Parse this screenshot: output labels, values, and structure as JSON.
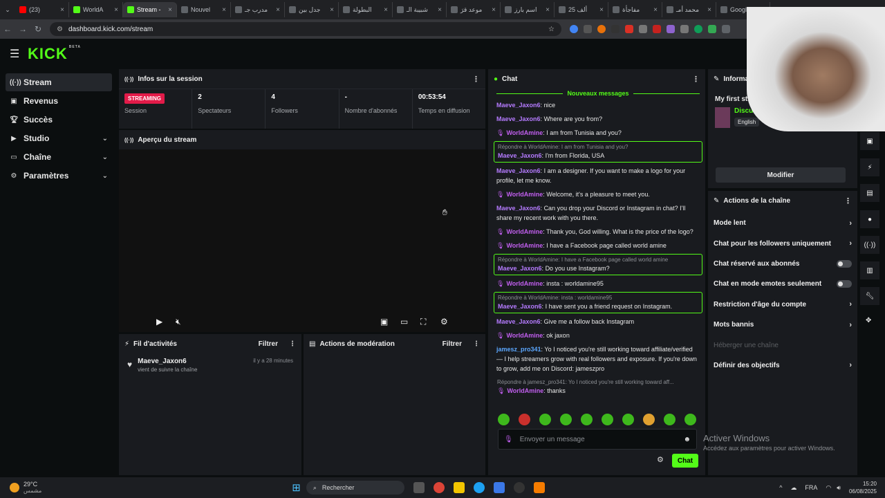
{
  "browser": {
    "tabs": [
      {
        "label": "(23)"
      },
      {
        "label": "WorldA"
      },
      {
        "label": "Stream -"
      },
      {
        "label": "Nouvel"
      },
      {
        "label": "مدرب جـ"
      },
      {
        "label": "جدل بين"
      },
      {
        "label": "البطولة"
      },
      {
        "label": "شبيبة الـ"
      },
      {
        "label": "موعد قرَ"
      },
      {
        "label": "اسم بارز"
      },
      {
        "label": "25 ألف"
      },
      {
        "label": "مفاجأة"
      },
      {
        "label": "محمد أمـ"
      },
      {
        "label": "Google"
      }
    ],
    "url": "dashboard.kick.com/stream"
  },
  "brand": {
    "logo": "KICK",
    "beta": "BETA",
    "accent": "#53fc18"
  },
  "sidebar": {
    "items": [
      {
        "label": "Stream",
        "icon": "broadcast-icon"
      },
      {
        "label": "Revenus",
        "icon": "wallet-icon"
      },
      {
        "label": "Succès",
        "icon": "trophy-icon"
      },
      {
        "label": "Studio",
        "icon": "camera-icon"
      },
      {
        "label": "Chaîne",
        "icon": "tv-icon"
      },
      {
        "label": "Paramètres",
        "icon": "gear-icon"
      }
    ]
  },
  "session": {
    "title": "Infos sur la session",
    "status_badge": "STREAMING",
    "stats": [
      {
        "value": "",
        "label": "Session"
      },
      {
        "value": "2",
        "label": "Spectateurs"
      },
      {
        "value": "4",
        "label": "Followers"
      },
      {
        "value": "-",
        "label": "Nombre d'abonnés"
      },
      {
        "value": "00:53:54",
        "label": "Temps en diffusion"
      }
    ],
    "preview_title": "Aperçu du stream"
  },
  "activity": {
    "title": "Fil d'activités",
    "filter": "Filtrer",
    "items": [
      {
        "user": "Maeve_Jaxon6",
        "action": "vient de suivre la chaîne",
        "time": "il y a 28 minutes"
      }
    ]
  },
  "moderation": {
    "title": "Actions de modération",
    "filter": "Filtrer"
  },
  "chat": {
    "title": "Chat",
    "new_messages": "Nouveaux messages",
    "messages": [
      {
        "user": "Maeve_Jaxon6",
        "text": "nice"
      },
      {
        "user": "Maeve_Jaxon6",
        "text": "Where are you from?"
      },
      {
        "user": "WorldAmine",
        "text": "I am from Tunisia and you?"
      },
      {
        "reply": "Répondre à WorldAmine: I am from Tunisia and you?",
        "user": "Maeve_Jaxon6",
        "text": "I'm from Florida, USA"
      },
      {
        "user": "Maeve_Jaxon6",
        "text": "I am a designer. If you want to make a logo for your profile, let me know."
      },
      {
        "user": "WorldAmine",
        "text": "Welcome, it's a pleasure to meet you."
      },
      {
        "user": "Maeve_Jaxon6",
        "text": "Can you drop your Discord or Instagram in chat? I'll share my recent work with you there."
      },
      {
        "user": "WorldAmine",
        "text": "Thank you, God willing. What is the price of the logo?"
      },
      {
        "user": "WorldAmine",
        "text": "I have a Facebook page called world amine"
      },
      {
        "reply": "Répondre à WorldAmine: I have a Facebook page called world amine",
        "user": "Maeve_Jaxon6",
        "text": "Do you use Instagram?"
      },
      {
        "user": "WorldAmine",
        "text": "insta : worldamine95"
      },
      {
        "reply": "Répondre à WorldAmine: insta : worldamine95",
        "user": "Maeve_Jaxon6",
        "text": "I have sent you a friend request on Instagram."
      },
      {
        "user": "Maeve_Jaxon6",
        "text": "Give me a follow back Instagram"
      },
      {
        "user": "WorldAmine",
        "text": "ok jaxon"
      },
      {
        "user": "jamesz_pro341",
        "text": "Yo I noticed you're still working toward affiliate/verified — I help streamers grow with real followers and exposure. If you're down to grow, add me on Discord: jameszpro"
      },
      {
        "reply": "Répondre à jamesz_pro341: Yo I noticed you're still working toward aff...",
        "user": "WorldAmine",
        "text": "thanks"
      }
    ],
    "input_placeholder": "Envoyer un message",
    "send_label": "Chat"
  },
  "info": {
    "title": "Informa",
    "stream_title": "My first stre",
    "category": "Discuss",
    "language": "English",
    "edit_label": "Modifier"
  },
  "channel_actions": {
    "title": "Actions de la chaîne",
    "items": [
      {
        "label": "Mode lent",
        "kind": "chevron"
      },
      {
        "label": "Chat pour les followers uniquement",
        "kind": "chevron"
      },
      {
        "label": "Chat réservé aux abonnés",
        "kind": "toggle"
      },
      {
        "label": "Chat en mode emotes seulement",
        "kind": "toggle"
      },
      {
        "label": "Restriction d'âge du compte",
        "kind": "chevron"
      },
      {
        "label": "Mots bannis",
        "kind": "chevron"
      },
      {
        "label": "Héberger une chaîne",
        "kind": "disabled"
      },
      {
        "label": "Définir des objectifs",
        "kind": "chevron"
      }
    ]
  },
  "watermark": {
    "line1": "Activer Windows",
    "line2": "Accédez aux paramètres pour activer Windows."
  },
  "taskbar": {
    "weather_temp": "29°C",
    "weather_desc": "مشمس",
    "search": "Rechercher",
    "lang": "FRA",
    "time": "15:20",
    "date": "06/08/2025"
  }
}
